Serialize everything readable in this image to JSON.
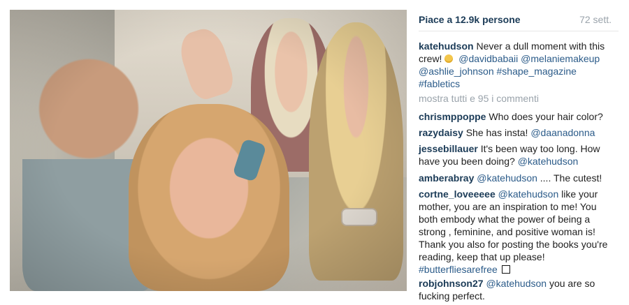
{
  "post": {
    "photo_alt_name": "group-selfie-photo",
    "likes": "Piace a 12.9k persone",
    "age": "72 sett.",
    "caption": {
      "author": "katehudson",
      "text_1": "Never a dull moment with this crew!",
      "emoji_icon": "grinning-face-icon",
      "mentions": [
        "@davidbabaii",
        "@melaniemakeup",
        "@ashlie_johnson"
      ],
      "hashtags": [
        "#shape_magazine",
        "#fabletics"
      ]
    },
    "more_comments": "mostra tutti e 95 i commenti",
    "comments": [
      {
        "user": "chrismppoppe",
        "text": "Who does your hair color?"
      },
      {
        "user": "razydaisy",
        "text": "She has insta!",
        "mention": "@daanadonna"
      },
      {
        "user": "jessebillauer",
        "text": "It's been way too long. How have you been doing?",
        "mention": "@katehudson"
      },
      {
        "user": "amberabray",
        "mention": "@katehudson",
        "text": ".... The cutest!"
      },
      {
        "user": "cortne_loveeeee",
        "mention": "@katehudson",
        "text": "like your mother, you are an inspiration to me! You both embody what the power of being a strong , feminine, and positive woman is! Thank you also for posting the books you're reading, keep that up please!",
        "hashtag": "#butterfliesarefree"
      },
      {
        "user": "robjohnson27",
        "mention": "@katehudson",
        "text": "you are so fucking perfect."
      }
    ]
  }
}
